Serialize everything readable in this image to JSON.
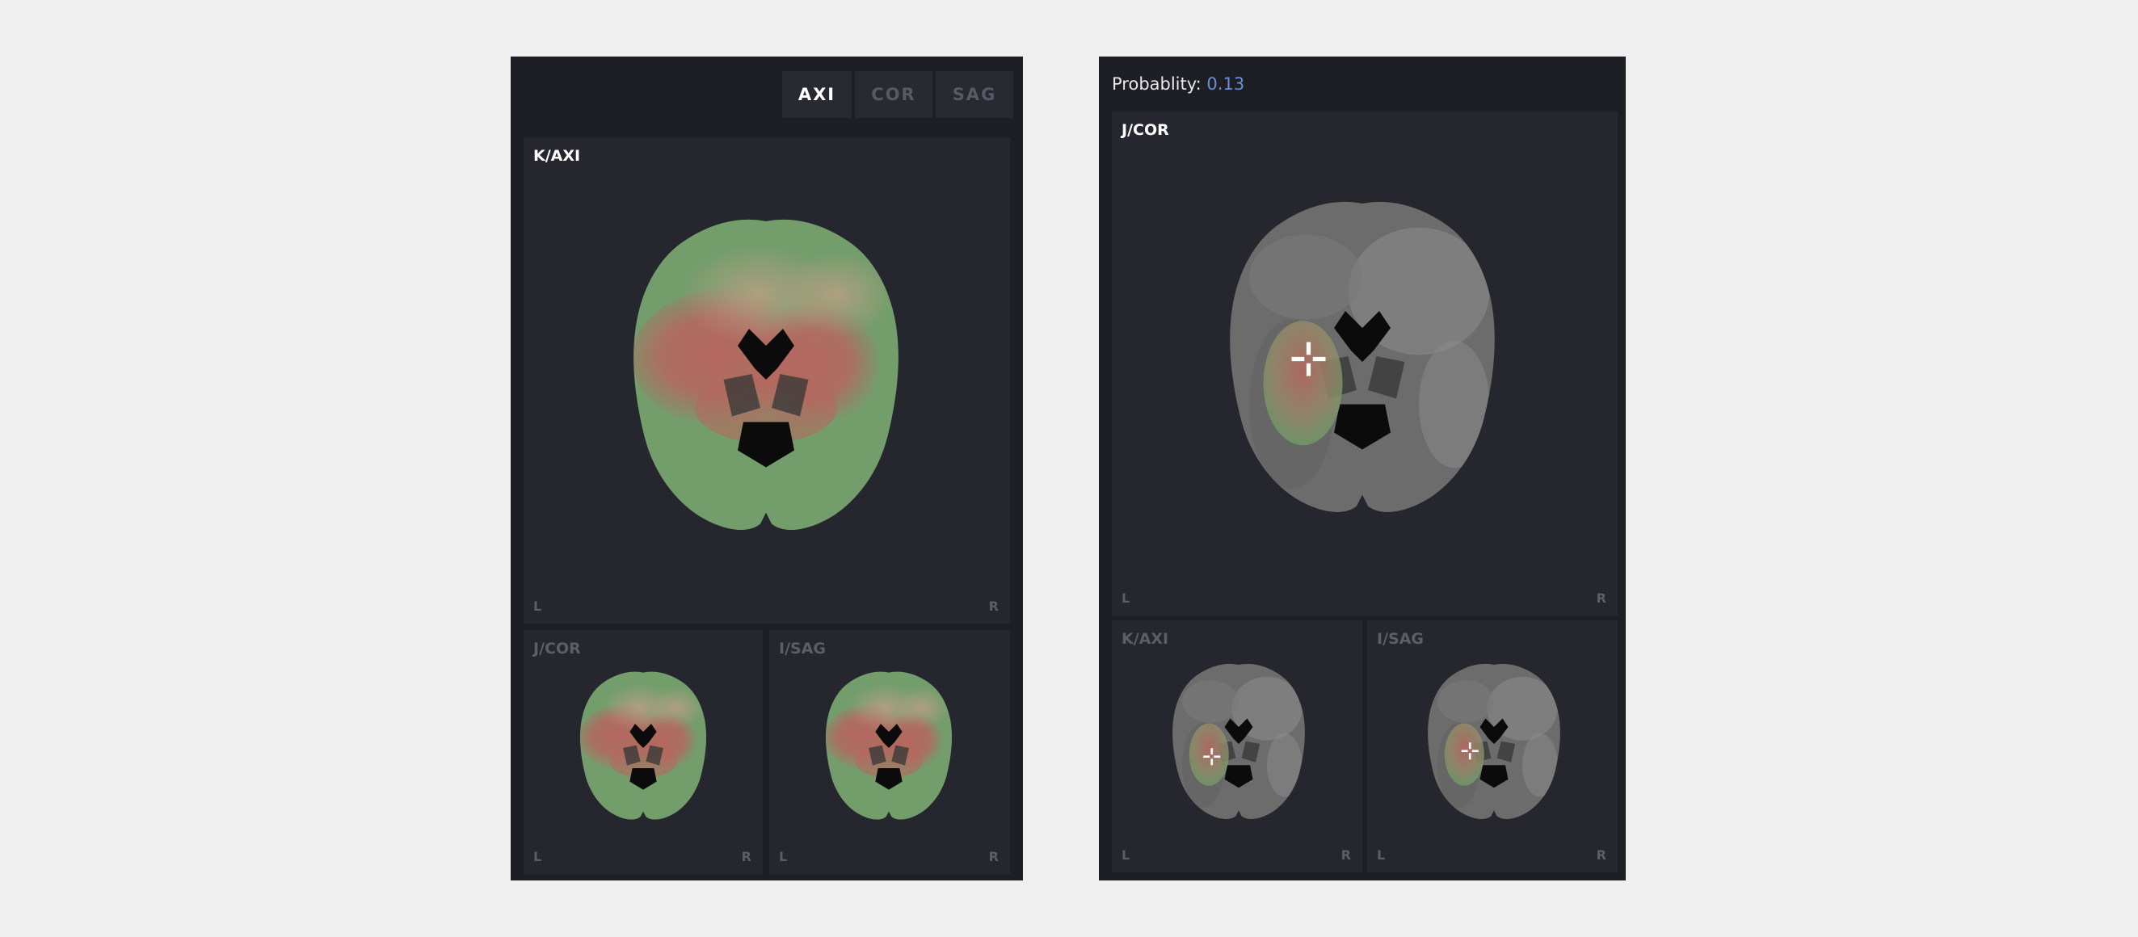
{
  "left": {
    "tabs": [
      {
        "label": "AXI",
        "active": true
      },
      {
        "label": "COR",
        "active": false
      },
      {
        "label": "SAG",
        "active": false
      }
    ],
    "main_view": {
      "label": "K/AXI",
      "left_marker": "L",
      "right_marker": "R"
    },
    "sub_views": [
      {
        "label": "J/COR",
        "left_marker": "L",
        "right_marker": "R"
      },
      {
        "label": "I/SAG",
        "left_marker": "L",
        "right_marker": "R"
      }
    ]
  },
  "right": {
    "probability_label": "Probablity:",
    "probability_value": "0.13",
    "main_view": {
      "label": "J/COR",
      "left_marker": "L",
      "right_marker": "R"
    },
    "sub_views": [
      {
        "label": "K/AXI",
        "left_marker": "L",
        "right_marker": "R"
      },
      {
        "label": "I/SAG",
        "left_marker": "L",
        "right_marker": "R"
      }
    ]
  },
  "colors": {
    "heat_green": "#6f9a66",
    "heat_red": "#b5675f",
    "gray_tissue": "#707070",
    "accent_blue": "#6b8ed6"
  },
  "icons": [
    "crosshair-icon"
  ]
}
